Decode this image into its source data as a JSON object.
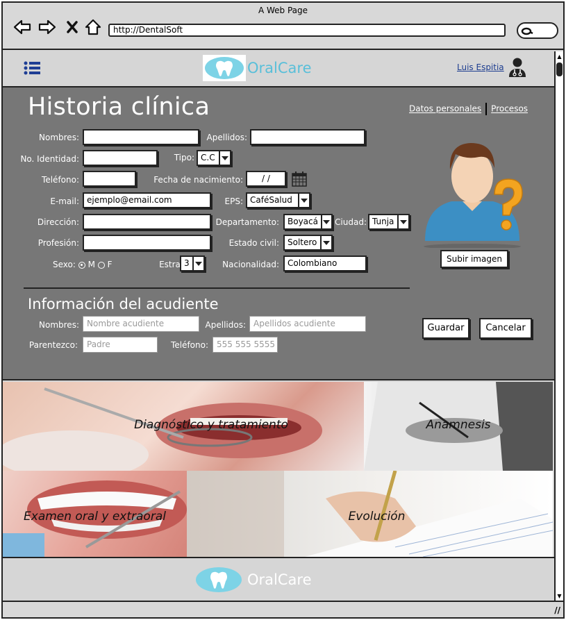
{
  "window": {
    "title": "A Web Page",
    "url": "http://DentalSoft"
  },
  "header": {
    "brand": "OralCare",
    "user": "Luis Espitia"
  },
  "page": {
    "title": "Historia clínica",
    "links": [
      "Datos personales",
      "Procesos"
    ]
  },
  "form": {
    "labels": {
      "nombres": "Nombres:",
      "apellidos": "Apellidos:",
      "identidad": "No. Identidad:",
      "tipo": "Tipo:",
      "telefono": "Teléfono:",
      "fecha": "Fecha de nacimiento:",
      "email": "E-mail:",
      "eps": "EPS:",
      "direccion": "Dirección:",
      "departamento": "Departamento:",
      "ciudad": "Ciudad:",
      "profesion": "Profesión:",
      "estado_civil": "Estado civil:",
      "sexo": "Sexo:",
      "estrato": "Estrato:",
      "nacionalidad": "Nacionalidad:"
    },
    "values": {
      "tipo": "C.C",
      "fecha": "/ /",
      "email": "ejemplo@email.com",
      "eps": "CaféSalud",
      "departamento": "Boyacá",
      "ciudad": "Tunja",
      "estado_civil": "Soltero",
      "sexo_m": "M",
      "sexo_f": "F",
      "estrato": "3",
      "nacionalidad": "Colombiano"
    },
    "upload_button": "Subir imagen"
  },
  "guardian": {
    "title": "Información del acudiente",
    "labels": {
      "nombres": "Nombres:",
      "apellidos": "Apellidos:",
      "parentezco": "Parentezco:",
      "telefono": "Teléfono:"
    },
    "placeholders": {
      "nombres": "Nombre acudiente",
      "apellidos": "Apellidos acudiente",
      "parentezco": "Padre",
      "telefono": "555 555 5555"
    }
  },
  "actions": {
    "save": "Guardar",
    "cancel": "Cancelar"
  },
  "tiles": [
    {
      "label": "Diagnóstico y tratamiento"
    },
    {
      "label": "Anamnesis"
    },
    {
      "label": "Examen oral y extraoral"
    },
    {
      "label": "Evolución"
    }
  ],
  "footer": {
    "brand": "OralCare"
  },
  "colors": {
    "brand": "#59bfd9",
    "panel": "#777777",
    "link": "#1c3c8f"
  }
}
